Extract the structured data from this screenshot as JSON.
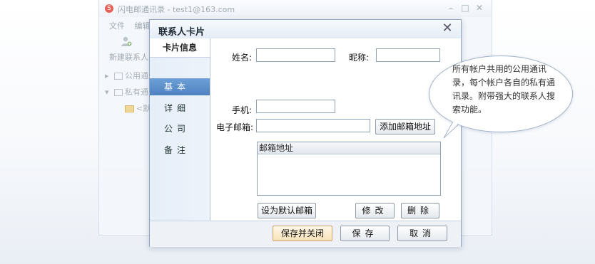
{
  "bg_window": {
    "title": "闪电邮通讯录 - test1@163.com",
    "logo": "S",
    "menu": [
      "文件",
      "编辑"
    ],
    "new_contact": "新建联系人",
    "tree": [
      "公用通",
      "私有通",
      "<默"
    ],
    "deco": "Y Z"
  },
  "dialog": {
    "title": "联系人卡片",
    "close_glyph": "✕",
    "sidebar": {
      "header": "卡片信息",
      "items": [
        {
          "label": "基本",
          "active": true
        },
        {
          "label": "详细",
          "active": false
        },
        {
          "label": "公司",
          "active": false
        },
        {
          "label": "备注",
          "active": false
        }
      ]
    },
    "form": {
      "name_label": "姓名:",
      "name_value": "",
      "nickname_label": "昵称:",
      "nickname_value": "",
      "mobile_label": "手机:",
      "mobile_value": "",
      "email_label": "电子邮箱:",
      "email_value": "",
      "add_email_button": "添加邮箱地址",
      "email_list_header": "邮箱地址",
      "set_default_button": "设为默认邮箱",
      "edit_button": "修改",
      "delete_button": "删除"
    },
    "footer": {
      "save_close_button": "保存并关闭",
      "save_button": "保存",
      "cancel_button": "取消"
    }
  },
  "callout": {
    "text": "所有帐户共用的公用通讯录，每个帐户各自的私有通讯录。附带强大的联系人搜索功能。"
  },
  "colors": {
    "active_tab": "#5a8cc8",
    "dialog_border": "#8fa7c4",
    "primary_button": "#f8e3b9"
  }
}
